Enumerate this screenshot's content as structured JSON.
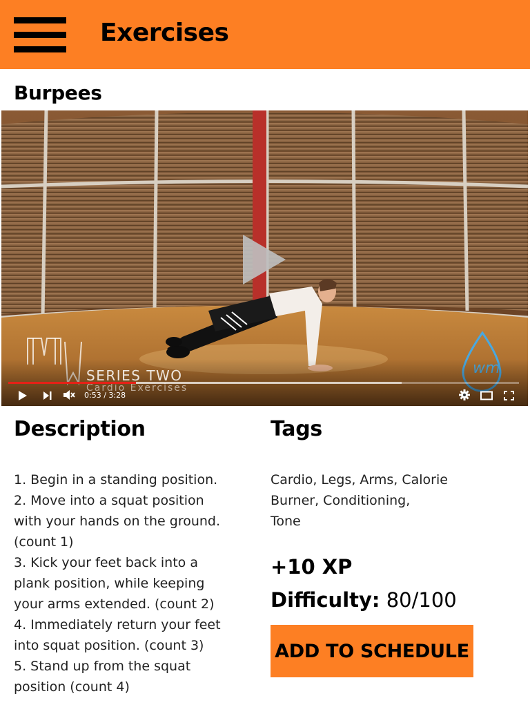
{
  "header": {
    "title": "Exercises",
    "menu_icon": "hamburger-menu-icon"
  },
  "exercise": {
    "name": "Burpees"
  },
  "video": {
    "brand_text": "SERIES TWO",
    "brand_subtext": "Cardio Exercises",
    "time_current": "0:53",
    "time_total": "3:28",
    "time_display": "0:53 / 3:28",
    "progress_fraction": 0.25,
    "buffered_fraction": 0.77,
    "colors": {
      "progress": "#e62117",
      "accent": "#fd7f23"
    }
  },
  "description": {
    "title": "Description",
    "lines": [
      "1. Begin in a standing position.",
      "2. Move into a squat position",
      "with your hands on the ground.",
      "(count 1)",
      "3. Kick your feet back into a",
      "plank position, while keeping",
      "your arms extended. (count 2)",
      "4. Immediately return your feet",
      "into squat position. (count 3)",
      "5. Stand up from the squat",
      "position (count 4)"
    ]
  },
  "tags": {
    "title": "Tags",
    "lines": [
      "Cardio, Legs, Arms, Calorie",
      "Burner, Conditioning,",
      "Tone"
    ]
  },
  "stats": {
    "xp": "+10 XP",
    "difficulty_label": "Difficulty:",
    "difficulty_value": "80/100"
  },
  "actions": {
    "add_to_schedule": "ADD TO SCHEDULE"
  }
}
